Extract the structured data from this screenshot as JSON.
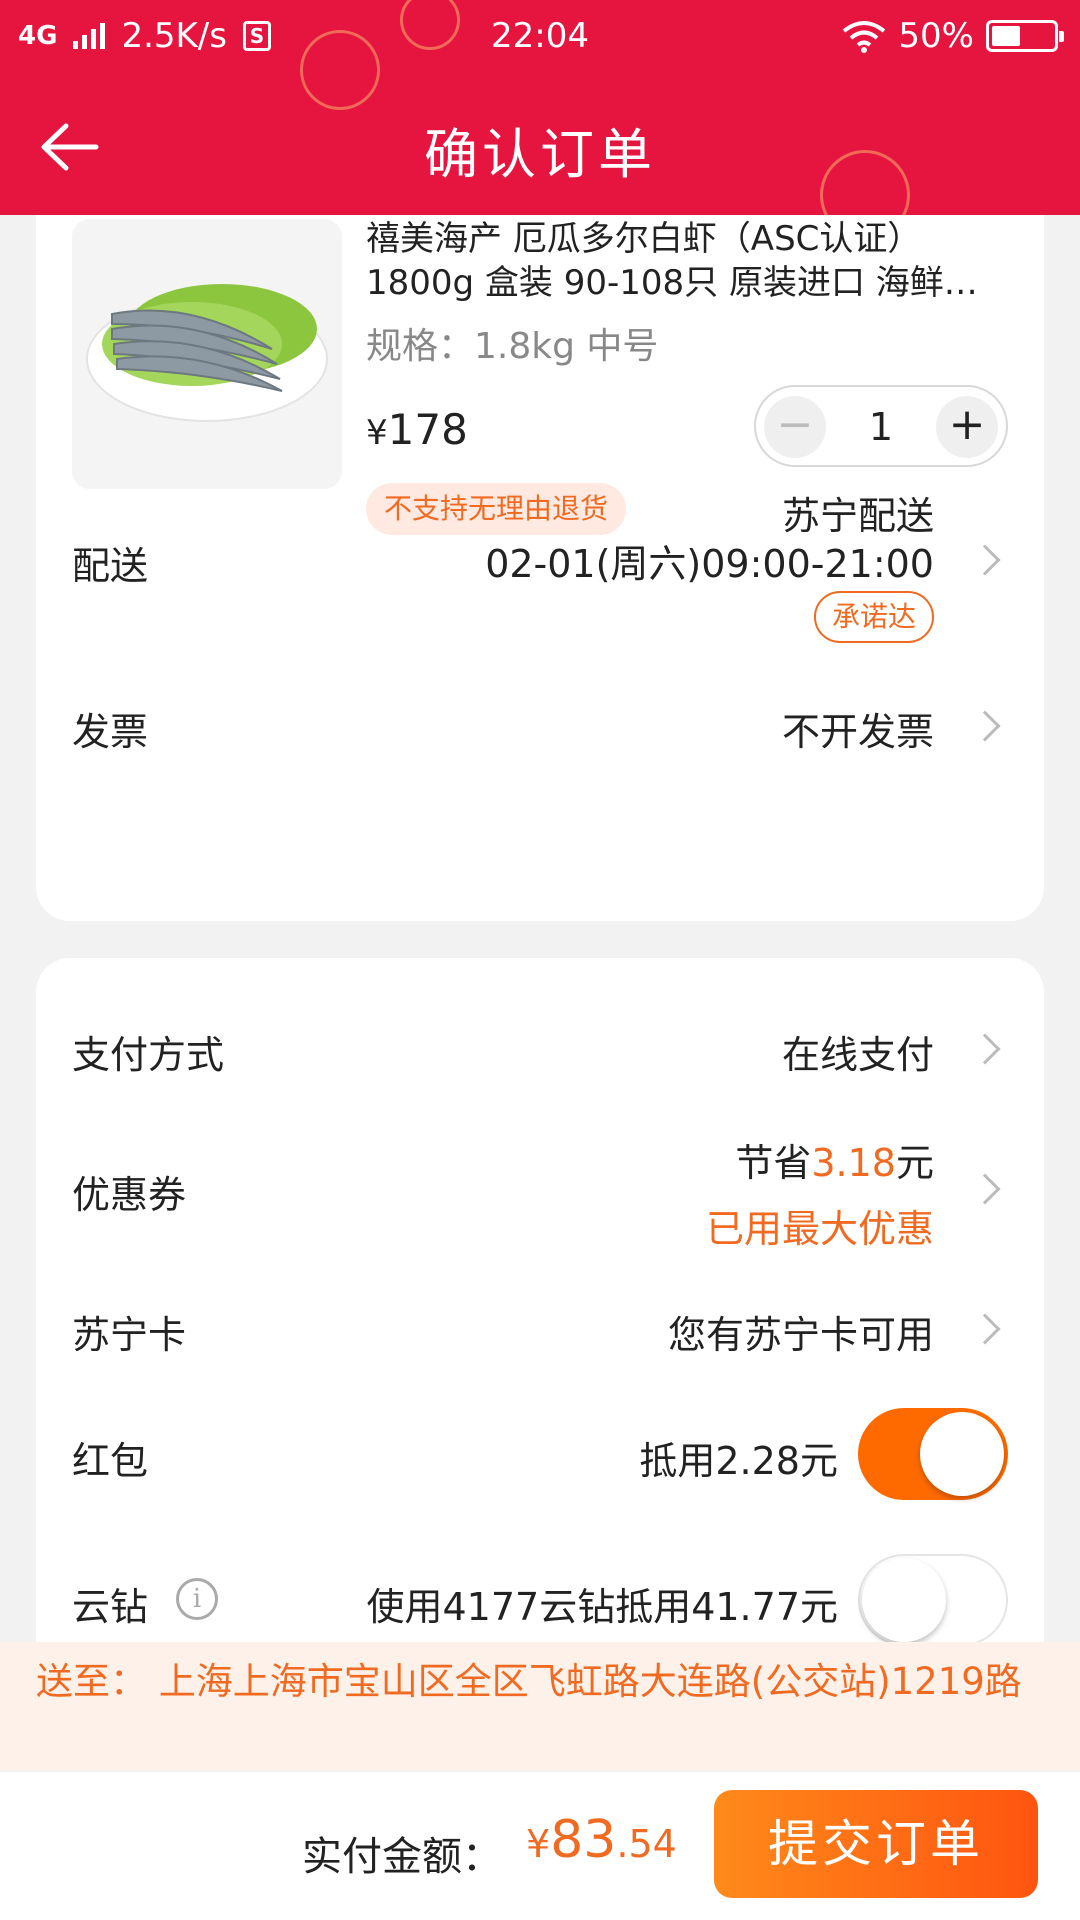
{
  "status_bar": {
    "network": "4G",
    "speed": "2.5K/s",
    "sim_icon": "S",
    "time": "22:04",
    "battery": "50%"
  },
  "header": {
    "title": "确认订单",
    "back_icon": "arrow-left-icon"
  },
  "product": {
    "title_line1": "禧美海产 厄瓜多尔白虾（ASC认证）",
    "title_line2": "1800g 盒装 90-108只 原装进口 海鲜…",
    "spec": "规格：1.8kg 中号",
    "price_symbol": "¥",
    "price": "178",
    "quantity": "1",
    "minus_label": "−",
    "plus_label": "+",
    "return_policy": "不支持无理由退货"
  },
  "delivery": {
    "label": "配送",
    "carrier": "苏宁配送",
    "time": "02-01(周六)09:00-21:00",
    "badge": "承诺达"
  },
  "invoice": {
    "label": "发票",
    "value": "不开发票"
  },
  "payment": {
    "label": "支付方式",
    "value": "在线支付"
  },
  "coupon": {
    "label": "优惠券",
    "save_prefix": "节省",
    "save_amount": "3.18",
    "save_suffix": "元",
    "status": "已用最大优惠"
  },
  "suning_card": {
    "label": "苏宁卡",
    "value": "您有苏宁卡可用"
  },
  "red_packet": {
    "label": "红包",
    "value": "抵用2.28元",
    "enabled": true
  },
  "cloud_diamond": {
    "label": "云钻",
    "info_icon": "i",
    "value": "使用4177云钻抵用41.77元",
    "enabled": false
  },
  "address": {
    "text": "送至：  上海上海市宝山区全区飞虹路大连路(公交站)1219路"
  },
  "footer": {
    "total_label": "实付金额：",
    "currency": "¥",
    "amount_int": "83",
    "amount_dec": ".54",
    "submit_label": "提交订单"
  },
  "colors": {
    "header_red": "#e5153f",
    "accent_orange": "#f06a21",
    "toggle_orange": "#ff6a00"
  }
}
